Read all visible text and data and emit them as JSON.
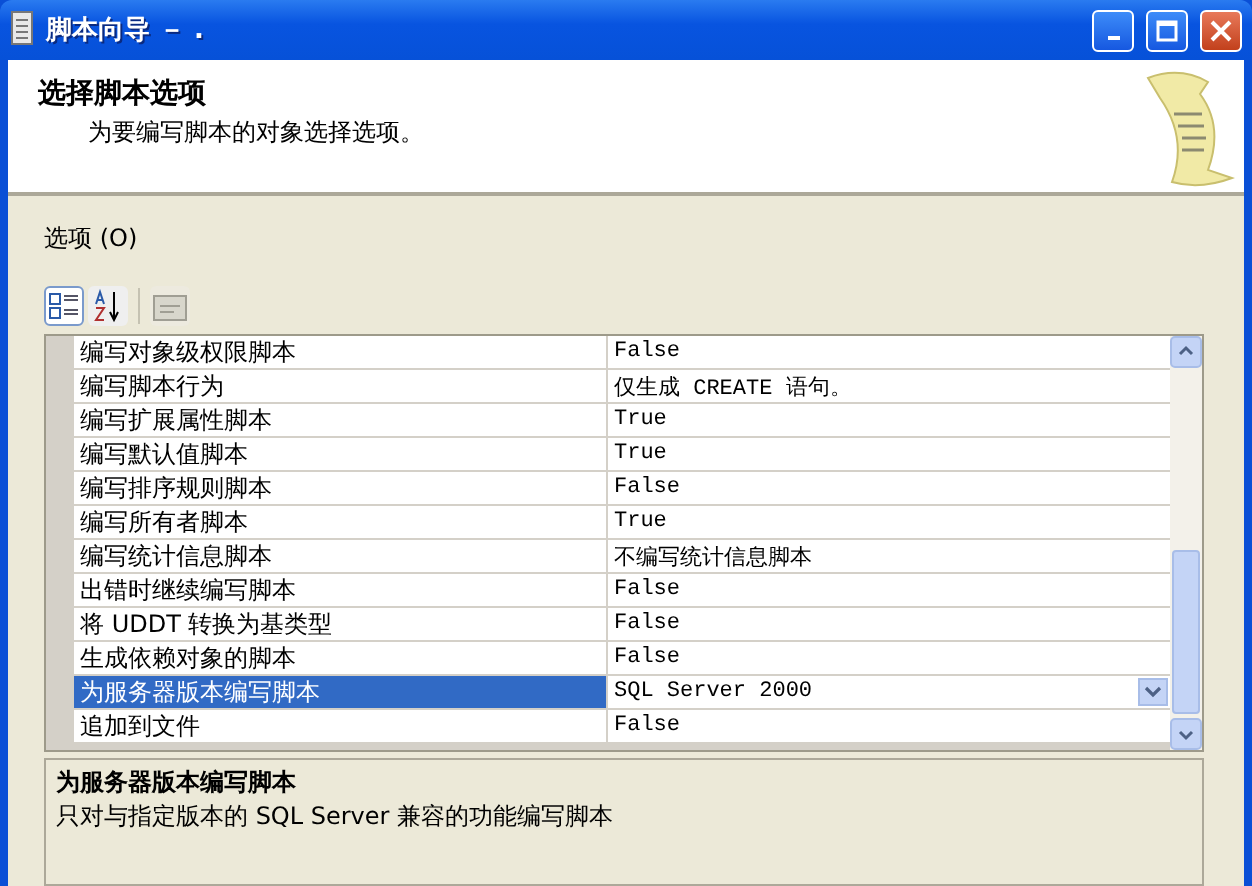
{
  "window": {
    "title": "脚本向导 － ."
  },
  "header": {
    "title": "选择脚本选项",
    "subtitle": "为要编写脚本的对象选择选项。"
  },
  "options_label": "选项 (O)",
  "properties": [
    {
      "name": "编写对象级权限脚本",
      "value": "False",
      "kind": "text",
      "selected": false
    },
    {
      "name": "编写脚本行为",
      "value": "仅生成 CREATE 语句。",
      "kind": "text",
      "selected": false
    },
    {
      "name": "编写扩展属性脚本",
      "value": "True",
      "kind": "text",
      "selected": false
    },
    {
      "name": "编写默认值脚本",
      "value": "True",
      "kind": "text",
      "selected": false
    },
    {
      "name": "编写排序规则脚本",
      "value": "False",
      "kind": "text",
      "selected": false
    },
    {
      "name": "编写所有者脚本",
      "value": "True",
      "kind": "text",
      "selected": false
    },
    {
      "name": "编写统计信息脚本",
      "value": "不编写统计信息脚本",
      "kind": "text",
      "selected": false
    },
    {
      "name": "出错时继续编写脚本",
      "value": "False",
      "kind": "text",
      "selected": false
    },
    {
      "name": "将 UDDT 转换为基类型",
      "value": "False",
      "kind": "text",
      "selected": false
    },
    {
      "name": "生成依赖对象的脚本",
      "value": "False",
      "kind": "text",
      "selected": false
    },
    {
      "name": "为服务器版本编写脚本",
      "value": "SQL Server 2000",
      "kind": "dropdown",
      "selected": true
    },
    {
      "name": "追加到文件",
      "value": "False",
      "kind": "text",
      "selected": false
    }
  ],
  "description": {
    "title": "为服务器版本编写脚本",
    "text": "只对与指定版本的 SQL Server 兼容的功能编写脚本"
  }
}
